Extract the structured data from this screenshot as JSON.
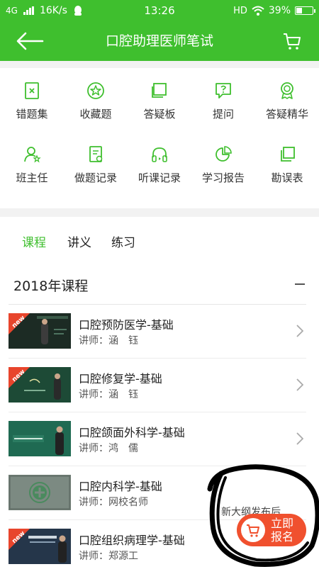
{
  "status_bar": {
    "network": "4G",
    "speed": "16K/s",
    "time": "13:26",
    "hd": "HD",
    "battery": "39%",
    "battery_level": 0.39
  },
  "header": {
    "title": "口腔助理医师笔试"
  },
  "toolbar": {
    "items": [
      {
        "label": "错题集",
        "icon": "wrong-question-book-icon"
      },
      {
        "label": "收藏题",
        "icon": "star-icon"
      },
      {
        "label": "答疑板",
        "icon": "board-icon"
      },
      {
        "label": "提问",
        "icon": "question-bubble-icon"
      },
      {
        "label": "答疑精华",
        "icon": "medal-icon"
      },
      {
        "label": "班主任",
        "icon": "teacher-icon"
      },
      {
        "label": "做题记录",
        "icon": "record-icon"
      },
      {
        "label": "听课记录",
        "icon": "headphones-icon"
      },
      {
        "label": "学习报告",
        "icon": "report-icon"
      },
      {
        "label": "勘误表",
        "icon": "copy-icon"
      }
    ]
  },
  "tabs": [
    {
      "label": "课程",
      "active": true
    },
    {
      "label": "讲义",
      "active": false
    },
    {
      "label": "练习",
      "active": false
    }
  ],
  "section": {
    "title": "2018年课程"
  },
  "courses": [
    {
      "name": "口腔预防医学-基础",
      "teacher": "讲师：涵　钰",
      "badge": "new"
    },
    {
      "name": "口腔修复学-基础",
      "teacher": "讲师：涵　钰",
      "badge": "new"
    },
    {
      "name": "口腔颌面外科学-基础",
      "teacher": "讲师：鸿　儒",
      "badge": ""
    },
    {
      "name": "口腔内科学-基础",
      "teacher": "讲师：网校名师",
      "badge": ""
    },
    {
      "name": "口腔组织病理学-基础",
      "teacher": "讲师：郑源工",
      "badge": "new"
    }
  ],
  "overlay_text": "新大纲发布后",
  "enroll_button": {
    "line1": "立即",
    "line2": "报名"
  },
  "colors": {
    "brand_green": "#3fbf2e",
    "accent_red": "#f0502e",
    "new_badge": "#e8452c"
  }
}
